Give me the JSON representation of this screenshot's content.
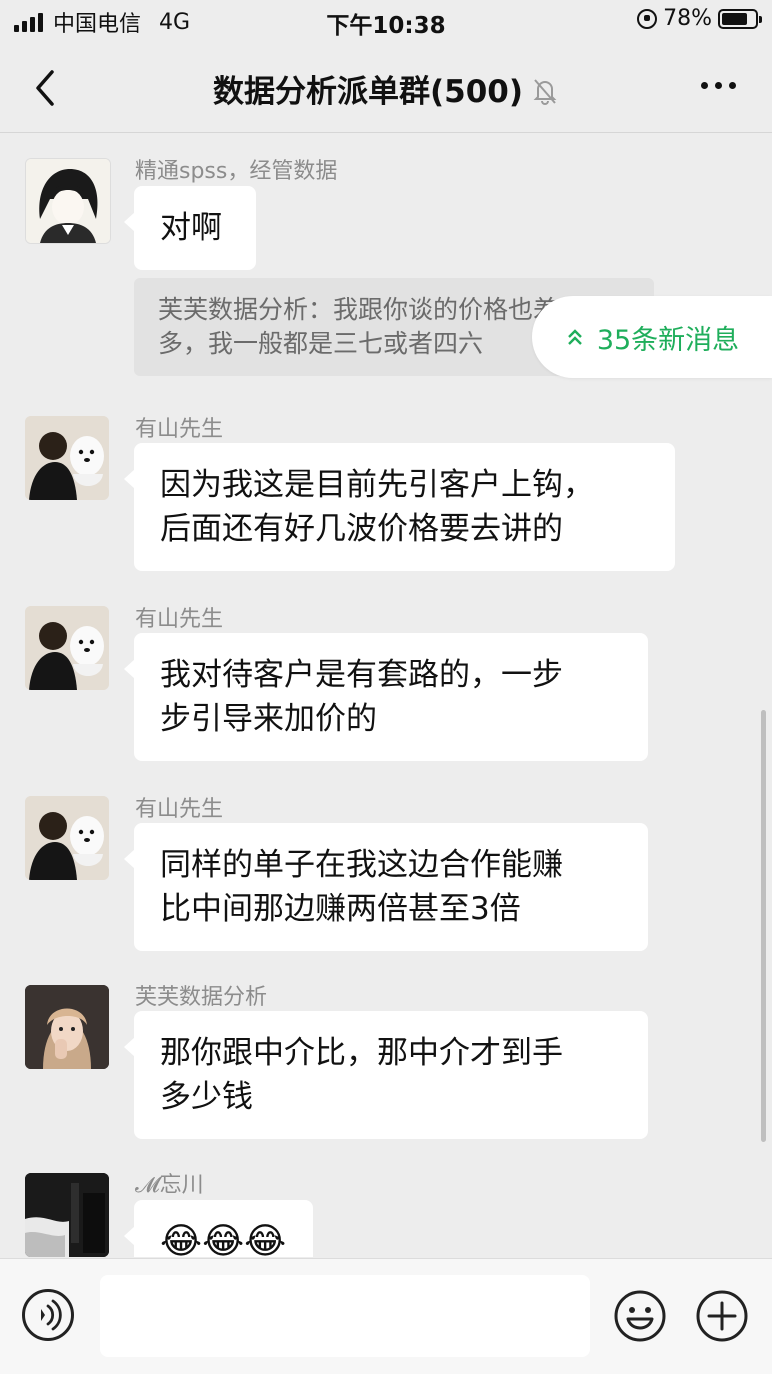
{
  "status_bar": {
    "carrier": "中国电信",
    "network": "4G",
    "time": "下午10:38",
    "battery": "78%",
    "battery_level": 0.78
  },
  "header": {
    "title": "数据分析派单群(500)",
    "back_icon": "chevron-left-icon",
    "mute_icon": "bell-muted-icon",
    "more_icon": "more-dots-icon"
  },
  "new_messages_banner": "35条新消息",
  "messages": [
    {
      "sender": "精通spss，经管数据",
      "text": "对啊",
      "quote": "芙芙数据分析：我跟你谈的价格也差不多，我一般都是三七或者四六"
    },
    {
      "sender": "有山先生",
      "text_lines": [
        "因为我这是目前先引客户上钩，",
        "后面还有好几波价格要去讲的"
      ]
    },
    {
      "sender": "有山先生",
      "text_lines": [
        "我对待客户是有套路的，一步",
        "步引导来加价的"
      ]
    },
    {
      "sender": "有山先生",
      "text_lines": [
        "同样的单子在我这边合作能赚",
        "比中间那边赚两倍甚至3倍"
      ]
    },
    {
      "sender": "芙芙数据分析",
      "text_lines": [
        "那你跟中介比，那中介才到手",
        "多少钱"
      ]
    },
    {
      "sender": "𝓜忘川",
      "text": "😂😂😂"
    }
  ],
  "input_bar": {
    "value": "",
    "voice_icon": "voice-icon",
    "emoji_icon": "emoji-icon",
    "plus_icon": "plus-icon"
  },
  "colors": {
    "background": "#ededed",
    "bubble": "#ffffff",
    "accent_green": "#1fae5b"
  }
}
